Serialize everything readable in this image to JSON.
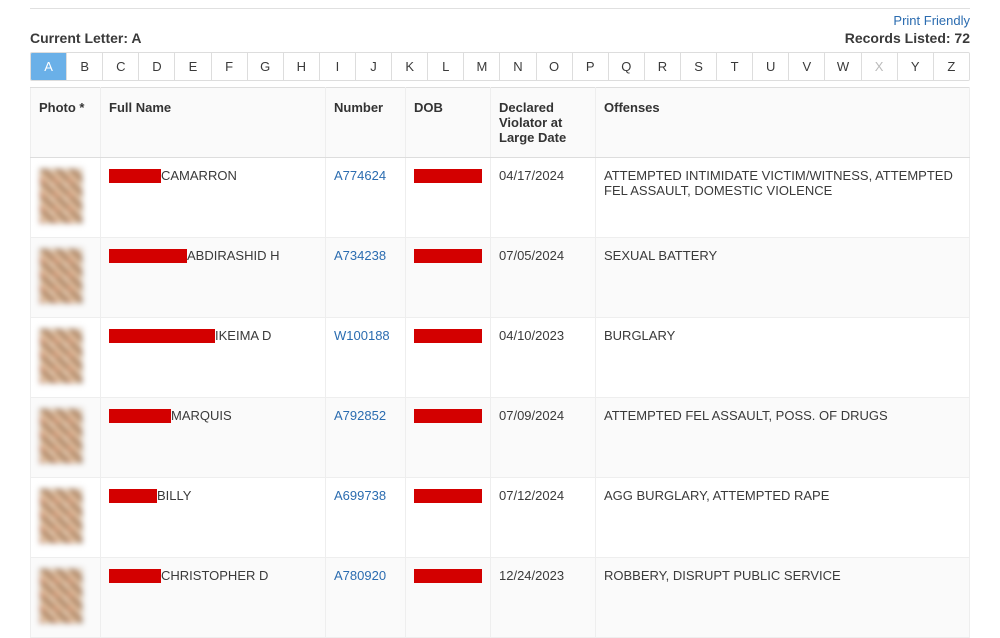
{
  "header": {
    "print_friendly": "Print Friendly",
    "current_letter_label": "Current Letter: A",
    "records_listed_label": "Records Listed: 72"
  },
  "letters": [
    {
      "label": "A",
      "state": "active"
    },
    {
      "label": "B",
      "state": "normal"
    },
    {
      "label": "C",
      "state": "normal"
    },
    {
      "label": "D",
      "state": "normal"
    },
    {
      "label": "E",
      "state": "normal"
    },
    {
      "label": "F",
      "state": "normal"
    },
    {
      "label": "G",
      "state": "normal"
    },
    {
      "label": "H",
      "state": "normal"
    },
    {
      "label": "I",
      "state": "normal"
    },
    {
      "label": "J",
      "state": "normal"
    },
    {
      "label": "K",
      "state": "normal"
    },
    {
      "label": "L",
      "state": "normal"
    },
    {
      "label": "M",
      "state": "normal"
    },
    {
      "label": "N",
      "state": "normal"
    },
    {
      "label": "O",
      "state": "normal"
    },
    {
      "label": "P",
      "state": "normal"
    },
    {
      "label": "Q",
      "state": "normal"
    },
    {
      "label": "R",
      "state": "normal"
    },
    {
      "label": "S",
      "state": "normal"
    },
    {
      "label": "T",
      "state": "normal"
    },
    {
      "label": "U",
      "state": "normal"
    },
    {
      "label": "V",
      "state": "normal"
    },
    {
      "label": "W",
      "state": "normal"
    },
    {
      "label": "X",
      "state": "disabled"
    },
    {
      "label": "Y",
      "state": "normal"
    },
    {
      "label": "Z",
      "state": "normal"
    }
  ],
  "columns": {
    "photo": "Photo *",
    "full_name": "Full Name",
    "number": "Number",
    "dob": "DOB",
    "declared_date": "Declared Violator at Large Date",
    "offenses": "Offenses"
  },
  "rows": [
    {
      "name_red_width": 52,
      "name_suffix": "CAMARRON",
      "number": "A774624",
      "declared_date": "04/17/2024",
      "offenses": "ATTEMPTED INTIMIDATE VICTIM/WITNESS, ATTEMPTED FEL ASSAULT, DOMESTIC VIOLENCE"
    },
    {
      "name_red_width": 78,
      "name_suffix": "ABDIRASHID H",
      "number": "A734238",
      "declared_date": "07/05/2024",
      "offenses": "SEXUAL BATTERY"
    },
    {
      "name_red_width": 106,
      "name_suffix": "IKEIMA D",
      "number": "W100188",
      "declared_date": "04/10/2023",
      "offenses": "BURGLARY"
    },
    {
      "name_red_width": 62,
      "name_suffix": "MARQUIS",
      "number": "A792852",
      "declared_date": "07/09/2024",
      "offenses": "ATTEMPTED FEL ASSAULT, POSS. OF DRUGS"
    },
    {
      "name_red_width": 48,
      "name_suffix": "BILLY",
      "number": "A699738",
      "declared_date": "07/12/2024",
      "offenses": "AGG BURGLARY, ATTEMPTED RAPE"
    },
    {
      "name_red_width": 52,
      "name_suffix": "CHRISTOPHER D",
      "number": "A780920",
      "declared_date": "12/24/2023",
      "offenses": "ROBBERY, DISRUPT PUBLIC SERVICE"
    }
  ]
}
